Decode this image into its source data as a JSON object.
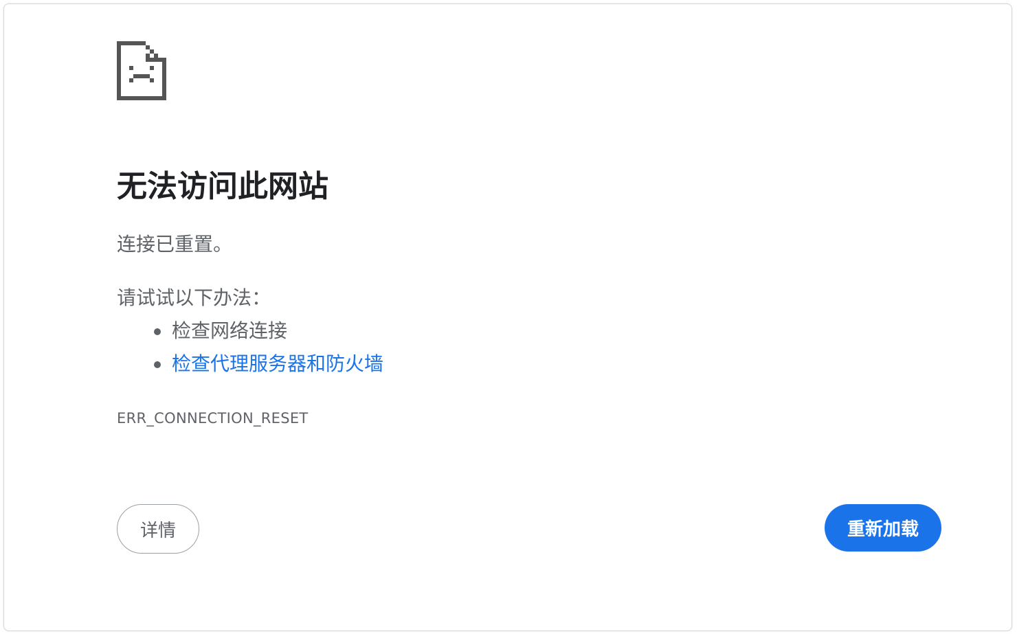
{
  "icon": {
    "name": "sad-page-icon"
  },
  "error": {
    "title": "无法访问此网站",
    "message": "连接已重置。",
    "suggestions_heading": "请试试以下办法：",
    "suggestions": [
      {
        "label": "检查网络连接",
        "is_link": false
      },
      {
        "label": "检查代理服务器和防火墙",
        "is_link": true
      }
    ],
    "code": "ERR_CONNECTION_RESET"
  },
  "buttons": {
    "details_label": "详情",
    "reload_label": "重新加载"
  },
  "colors": {
    "accent": "#1a73e8",
    "title_text": "#202124",
    "body_text": "#5f6368",
    "icon": "#555555",
    "details_border": "#9aa0a6"
  }
}
